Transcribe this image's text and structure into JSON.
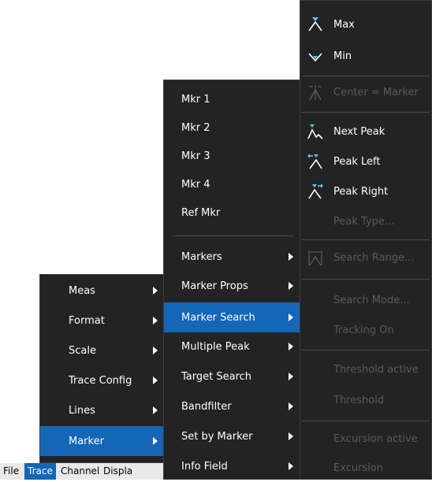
{
  "menubar": {
    "items": [
      "File",
      "Trace",
      "Channel",
      "Displa"
    ]
  },
  "menu1": [
    {
      "label": "Meas",
      "submenu": true
    },
    {
      "label": "Format",
      "submenu": true
    },
    {
      "label": "Scale",
      "submenu": true
    },
    {
      "label": "Trace Config",
      "submenu": true
    },
    {
      "label": "Lines",
      "submenu": true
    },
    {
      "label": "Marker",
      "submenu": true,
      "selected": true
    }
  ],
  "menu2": [
    {
      "label": "Mkr 1"
    },
    {
      "label": "Mkr 2"
    },
    {
      "label": "Mkr 3"
    },
    {
      "label": "Mkr 4"
    },
    {
      "label": "Ref Mkr"
    },
    {
      "label": "Markers",
      "submenu": true
    },
    {
      "label": "Marker Props",
      "submenu": true
    },
    {
      "label": "Marker Search",
      "submenu": true,
      "selected": true
    },
    {
      "label": "Multiple Peak",
      "submenu": true
    },
    {
      "label": "Target Search",
      "submenu": true
    },
    {
      "label": "Bandfilter",
      "submenu": true
    },
    {
      "label": "Set by Marker",
      "submenu": true
    },
    {
      "label": "Info Field",
      "submenu": true
    }
  ],
  "menu3": [
    {
      "label": "Max",
      "icon": "max-icon"
    },
    {
      "label": "Min",
      "icon": "min-icon"
    },
    {
      "label": "Center = Marker",
      "icon": "center-marker-icon",
      "disabled": true
    },
    {
      "label": "Next Peak",
      "icon": "next-peak-icon"
    },
    {
      "label": "Peak Left",
      "icon": "peak-left-icon"
    },
    {
      "label": "Peak Right",
      "icon": "peak-right-icon"
    },
    {
      "label": "Peak Type...",
      "disabled": true
    },
    {
      "label": "Search Range...",
      "icon": "search-range-icon",
      "disabled": true
    },
    {
      "label": "Search Mode...",
      "disabled": true
    },
    {
      "label": "Tracking On",
      "disabled": true
    },
    {
      "label": "Threshold active",
      "disabled": true
    },
    {
      "label": "Threshold",
      "disabled": true
    },
    {
      "label": "Excursion active",
      "disabled": true
    },
    {
      "label": "Excursion",
      "disabled": true
    }
  ],
  "colors": {
    "menu_bg": "#232323",
    "selected": "#1366b8",
    "disabled_text": "#5a5a5a",
    "icon_accent": "#5cc6f2"
  }
}
